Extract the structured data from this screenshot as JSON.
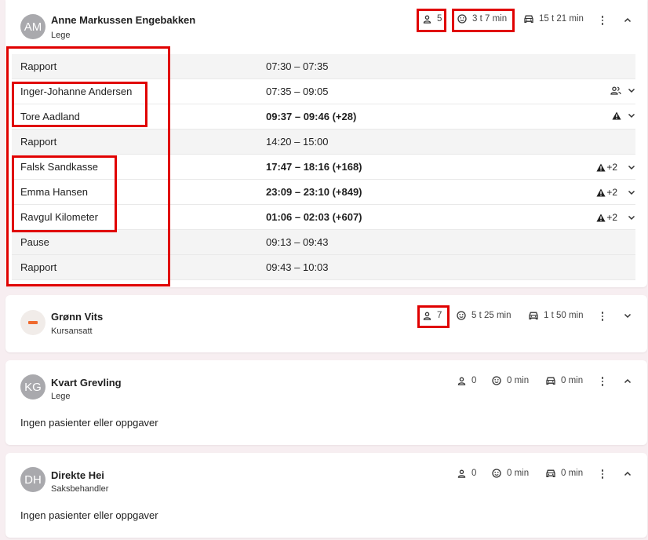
{
  "staff": [
    {
      "initials": "AM",
      "name": "Anne Markussen Engebakken",
      "role": "Lege",
      "patients": "5",
      "treatment_time": "3 t 7 min",
      "travel_time": "15 t 21 min",
      "rows": [
        {
          "label": "Rapport",
          "time": "07:30 – 07:35",
          "bold": false,
          "grey": true
        },
        {
          "label": "Inger-Johanne Andersen",
          "time": "07:35 – 09:05",
          "bold": false,
          "grey": false,
          "indicator": "group"
        },
        {
          "label": "Tore Aadland",
          "time": "09:37 – 09:46 (+28)",
          "bold": true,
          "grey": false,
          "indicator": "warning"
        },
        {
          "label": "Rapport",
          "time": "14:20 – 15:00",
          "bold": false,
          "grey": true
        },
        {
          "label": "Falsk Sandkasse",
          "time": "17:47 – 18:16 (+168)",
          "bold": true,
          "grey": false,
          "indicator": "warning",
          "extra": "+2"
        },
        {
          "label": "Emma Hansen",
          "time": "23:09 – 23:10 (+849)",
          "bold": true,
          "grey": false,
          "indicator": "warning",
          "extra": "+2"
        },
        {
          "label": "Ravgul Kilometer",
          "time": "01:06 – 02:03 (+607)",
          "bold": true,
          "grey": false,
          "indicator": "warning",
          "extra": "+2"
        },
        {
          "label": "Pause",
          "time": "09:13 – 09:43",
          "bold": false,
          "grey": true
        },
        {
          "label": "Rapport",
          "time": "09:43 – 10:03",
          "bold": false,
          "grey": true
        }
      ]
    },
    {
      "initials": "",
      "name": "Grønn Vits",
      "role": "Kursansatt",
      "patients": "7",
      "treatment_time": "5 t 25 min",
      "travel_time": "1 t 50 min"
    },
    {
      "initials": "KG",
      "name": "Kvart Grevling",
      "role": "Lege",
      "patients": "0",
      "treatment_time": "0 min",
      "travel_time": "0 min",
      "empty_text": "Ingen pasienter eller oppgaver"
    },
    {
      "initials": "DH",
      "name": "Direkte Hei",
      "role": "Saksbehandler",
      "patients": "0",
      "treatment_time": "0 min",
      "travel_time": "0 min",
      "empty_text": "Ingen pasienter eller oppgaver"
    }
  ],
  "colors": {
    "highlight": "#e00000",
    "row_grey": "#f4f4f4",
    "avatar_grey": "#a9a9ad",
    "status_orange": "#ef6a2e"
  }
}
